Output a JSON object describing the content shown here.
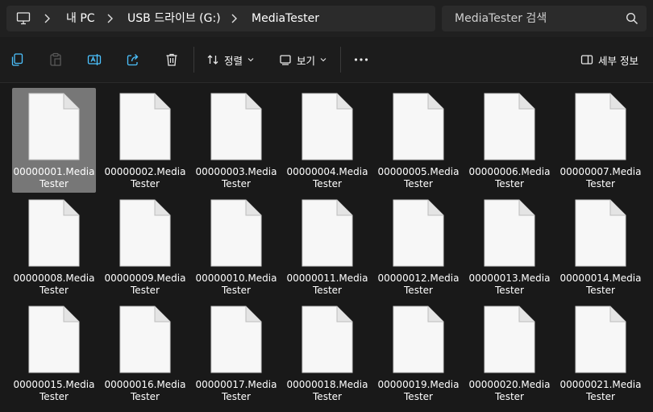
{
  "breadcrumb": {
    "items": [
      "내 PC",
      "USB 드라이브 (G:)",
      "MediaTester"
    ]
  },
  "search": {
    "placeholder": "MediaTester 검색"
  },
  "toolbar": {
    "sort_label": "정렬",
    "view_label": "보기",
    "details_label": "세부 정보",
    "icons": [
      "copy-icon",
      "paste-icon",
      "rename-icon",
      "share-icon",
      "delete-icon",
      "sort-icon",
      "view-icon",
      "more-icon",
      "details-pane-icon"
    ]
  },
  "files": [
    {
      "line1": "00000001.Media",
      "line2": "Tester",
      "selected": true
    },
    {
      "line1": "00000002.Media",
      "line2": "Tester"
    },
    {
      "line1": "00000003.Media",
      "line2": "Tester"
    },
    {
      "line1": "00000004.Media",
      "line2": "Tester"
    },
    {
      "line1": "00000005.Media",
      "line2": "Tester"
    },
    {
      "line1": "00000006.Media",
      "line2": "Tester"
    },
    {
      "line1": "00000007.Media",
      "line2": "Tester"
    },
    {
      "line1": "00000008.Media",
      "line2": "Tester"
    },
    {
      "line1": "00000009.Media",
      "line2": "Tester"
    },
    {
      "line1": "00000010.Media",
      "line2": "Tester"
    },
    {
      "line1": "00000011.Media",
      "line2": "Tester"
    },
    {
      "line1": "00000012.Media",
      "line2": "Tester"
    },
    {
      "line1": "00000013.Media",
      "line2": "Tester"
    },
    {
      "line1": "00000014.Media",
      "line2": "Tester"
    },
    {
      "line1": "00000015.Media",
      "line2": "Tester"
    },
    {
      "line1": "00000016.Media",
      "line2": "Tester"
    },
    {
      "line1": "00000017.Media",
      "line2": "Tester"
    },
    {
      "line1": "00000018.Media",
      "line2": "Tester"
    },
    {
      "line1": "00000019.Media",
      "line2": "Tester"
    },
    {
      "line1": "00000020.Media",
      "line2": "Tester"
    },
    {
      "line1": "00000021.Media",
      "line2": "Tester"
    }
  ],
  "colors": {
    "background": "#191919",
    "selection": "#777777",
    "accent": "#4cc2ff"
  }
}
